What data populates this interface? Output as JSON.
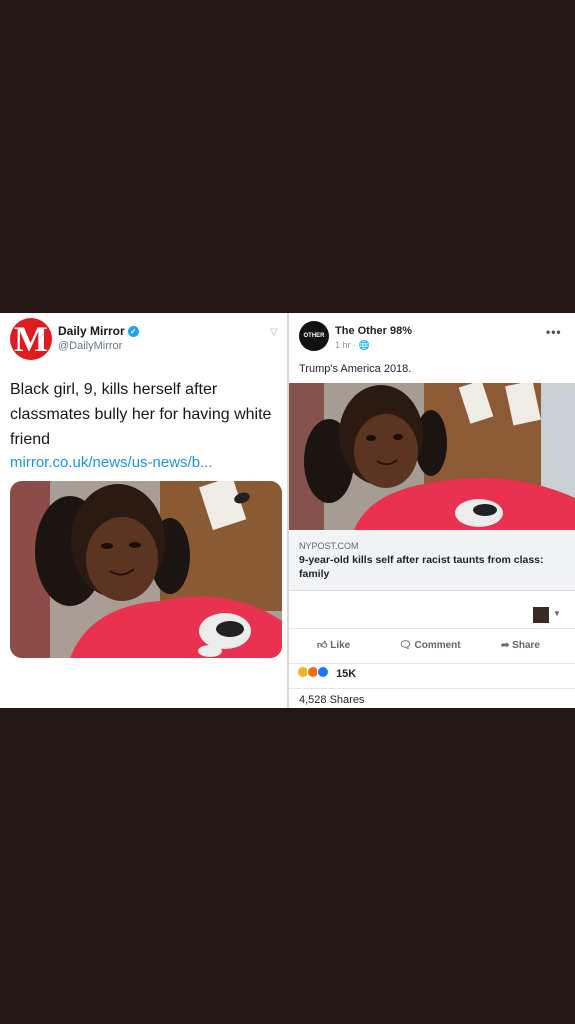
{
  "tweet": {
    "logo_letter": "M",
    "account_name": "Daily Mirror",
    "handle": "@DailyMirror",
    "text": "Black girl, 9, kills herself after classmates bully her for having white friend",
    "link": "mirror.co.uk/news/us-news/b...",
    "icons": {
      "verified": "verified-badge-icon",
      "caret": "chevron-down-icon"
    }
  },
  "post": {
    "page_name": "The Other 98%",
    "avatar_text": "OTHER 98%",
    "time": "1 hr · ",
    "caption": "Trump's America 2018.",
    "link_source": "NYPOST.COM",
    "link_headline": "9-year-old kills self after racist taunts from class: family",
    "actions": {
      "like": "Like",
      "comment": "Comment",
      "share": "Share"
    },
    "reaction_count": "15K",
    "shares": "4,528 Shares",
    "icons": {
      "more": "more-dots-icon",
      "globe": "globe-icon",
      "like": "thumbs-up-icon",
      "comment": "speech-bubble-icon",
      "share": "share-arrow-icon"
    }
  },
  "colors": {
    "background": "#231716",
    "mirror_red": "#e11a1f",
    "twitter_link": "#1b95e0",
    "shirt_pink": "#e8324f"
  }
}
